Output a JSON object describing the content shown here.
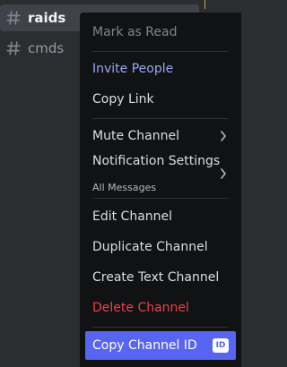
{
  "sidebar": {
    "channels": [
      {
        "label": "raids",
        "icon": "hashtag-icon",
        "active": true
      },
      {
        "label": "cmds",
        "icon": "hashtag-icon",
        "active": false
      }
    ]
  },
  "context_menu": {
    "mark_as_read": "Mark as Read",
    "invite_people": "Invite People",
    "copy_link": "Copy Link",
    "mute_channel": "Mute Channel",
    "notification_settings": "Notification Settings",
    "notification_value": "All Messages",
    "edit_channel": "Edit Channel",
    "duplicate_channel": "Duplicate Channel",
    "create_text_channel": "Create Text Channel",
    "delete_channel": "Delete Channel",
    "copy_channel_id": "Copy Channel ID",
    "id_badge": "ID"
  },
  "colors": {
    "background": "#2b2d31",
    "menu_background": "#111214",
    "accent": "#9ba6f7",
    "danger": "#f23f42",
    "highlight": "#5865f2"
  }
}
